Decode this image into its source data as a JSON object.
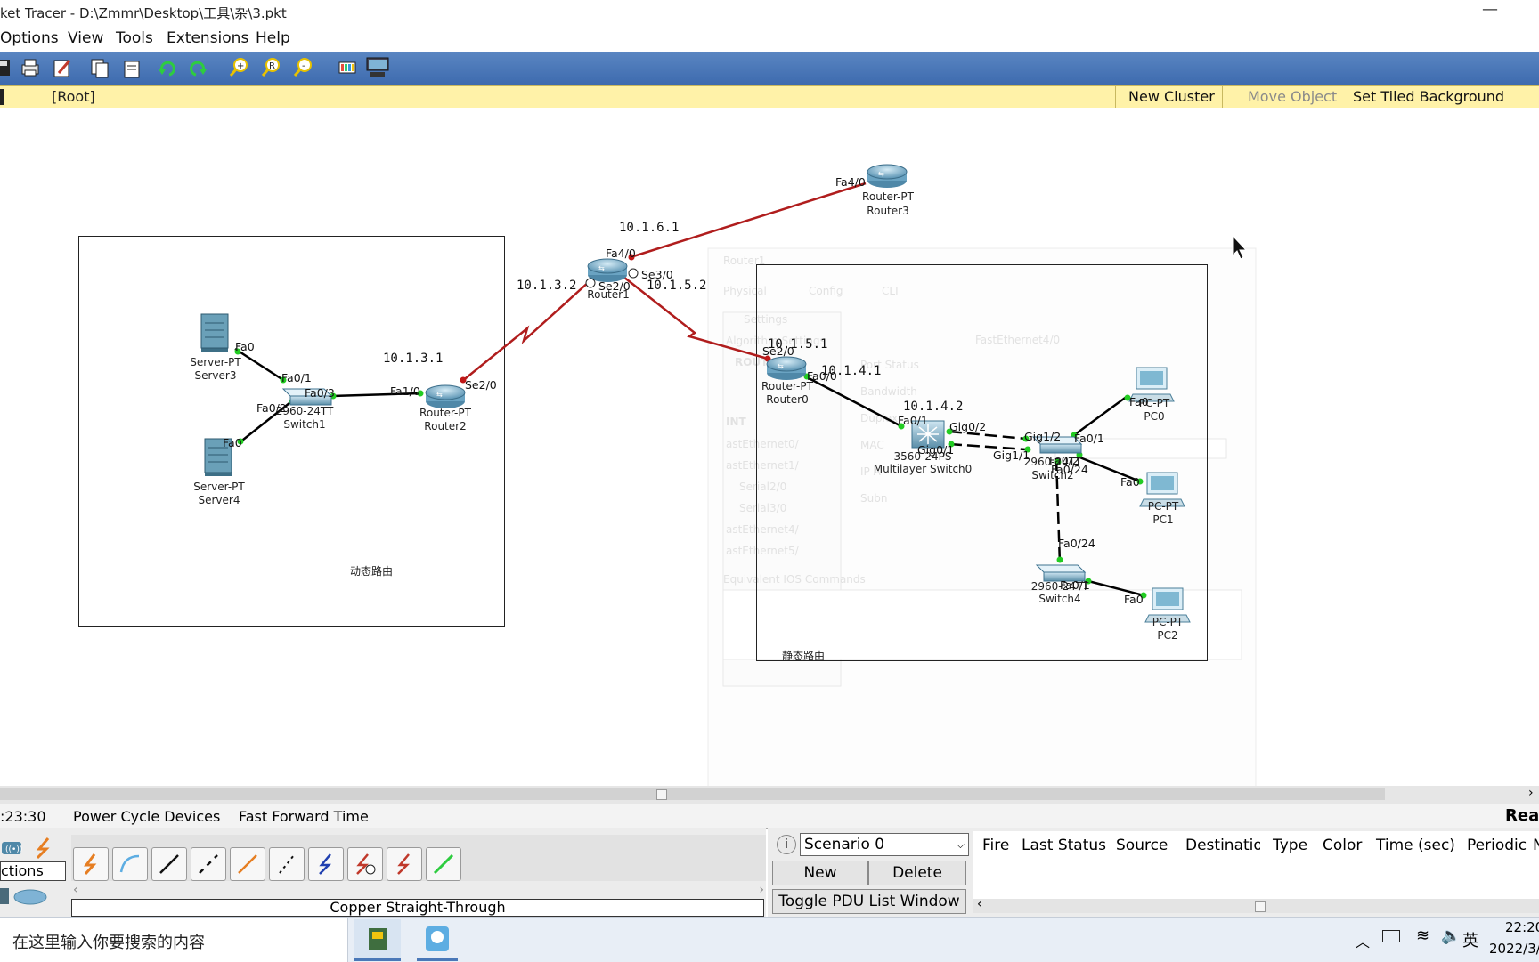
{
  "titlebar": {
    "title": "ket Tracer - D:\\Zmmr\\Desktop\\工具\\杂\\3.pkt",
    "minimize": "—",
    "close": "✕"
  },
  "menu": {
    "items": [
      "Options",
      "View",
      "Tools",
      "Extensions",
      "Help"
    ]
  },
  "logical_bar": {
    "root": "[Root]",
    "new_cluster": "New Cluster",
    "move_object": "Move Object",
    "set_tiled_background": "Set Tiled Background"
  },
  "topology": {
    "devices": {
      "router3": {
        "type": "Router-PT",
        "name": "Router3"
      },
      "router1": {
        "type": "",
        "name": "Router1"
      },
      "router0": {
        "type": "Router-PT",
        "name": "Router0"
      },
      "router2": {
        "type": "Router-PT",
        "name": "Router2"
      },
      "server3": {
        "type": "Server-PT",
        "name": "Server3"
      },
      "server4": {
        "type": "Server-PT",
        "name": "Server4"
      },
      "switch1": {
        "type": "2960-24TT",
        "name": "Switch1"
      },
      "mlswitch0": {
        "type": "3560-24PS",
        "name": "Multilayer Switch0"
      },
      "switch2": {
        "type": "2960-24TT",
        "name": "Switch2"
      },
      "switch4": {
        "type": "2960-24TT",
        "name": "Switch4"
      },
      "pc0": {
        "type": "PC-PT",
        "name": "PC0"
      },
      "pc1": {
        "type": "PC-PT",
        "name": "PC1"
      },
      "pc2": {
        "type": "PC-PT",
        "name": "PC2"
      }
    },
    "ip_labels": {
      "r1_fa40": "10.1.6.1",
      "r1_se20": "10.1.3.2",
      "r1_se30": "10.1.5.2",
      "r2_se20": "10.1.3.1",
      "r0_se20": "10.1.5.1",
      "r0_fa00": "10.1.4.1",
      "mls_fa01": "10.1.4.2"
    },
    "interfaces": {
      "r3_fa40": "Fa4/0",
      "r1_fa40": "Fa4/0",
      "r1_se20": "Se2/0",
      "r1_se30": "Se3/0",
      "r0_se20": "Se2/0",
      "r0_fa00": "Fa0/0",
      "r2_se20": "Se2/0",
      "r2_fa10": "Fa1/0",
      "sw1_fa01": "Fa0/1",
      "sw1_fa03": "Fa0/3",
      "sw1_fa02": "Fa0/2",
      "sv3_fa0": "Fa0",
      "sv4_fa0": "Fa0",
      "mls_fa01": "Fa0/1",
      "mls_gig02": "Gig0/2",
      "mls_gig01": "Gig0/1",
      "sw2_gig12": "Gig1/2",
      "sw2_gig11": "Gig1/1",
      "sw2_fa01": "Fa0/1",
      "sw2_fa02": "Fa0/2",
      "sw2_fa024": "Fa0/24",
      "sw4_fa024": "Fa0/24",
      "sw4_fa01": "Fa0/1",
      "pc0_fa0": "Fa0",
      "pc1_fa0": "Fa0",
      "pc2_fa0": "Fa0"
    },
    "notes": {
      "dynamic": "动态路由",
      "static": "静态路由"
    }
  },
  "ghost_dialog": {
    "title": "Router1",
    "tabs": [
      "Physical",
      "Config",
      "CLI"
    ],
    "heading": "FastEthernet4/0",
    "fields": [
      "Port Status",
      "Bandwidth",
      "Duplex",
      "MAC",
      "IP A",
      "Subn"
    ],
    "side_items": [
      "Settings",
      "Algorithm Settings",
      "ROUTING",
      "INT",
      "astEthernet0/",
      "astEthernet1/",
      "Serial2/0",
      "Serial3/0",
      "astEthernet4/",
      "astEthernet5/"
    ],
    "equiv": "Equivalent IOS Commands"
  },
  "statusbar": {
    "time": ":23:30",
    "power_cycle": "Power Cycle Devices",
    "fast_forward": "Fast Forward Time",
    "realtime": "Rea"
  },
  "device_panel": {
    "category": "ctions",
    "connection_name": "Copper Straight-Through"
  },
  "pdu": {
    "scenario": "Scenario 0",
    "new": "New",
    "delete": "Delete",
    "toggle": "Toggle PDU List Window",
    "columns": [
      "Fire",
      "Last Status",
      "Source",
      "Destinatior",
      "Type",
      "Color",
      "Time (sec)",
      "Periodic",
      "N"
    ]
  },
  "taskbar": {
    "search_placeholder": "在这里输入你要搜索的内容",
    "clock_time": "22:20",
    "clock_date": "2022/3/",
    "ime": "英"
  },
  "colors": {
    "serial_link": "#b01d1d",
    "copper_link": "#000000",
    "toolbar": "#4a78b8",
    "logical_bar": "#fff2a8",
    "port_up": "#22cc22"
  }
}
